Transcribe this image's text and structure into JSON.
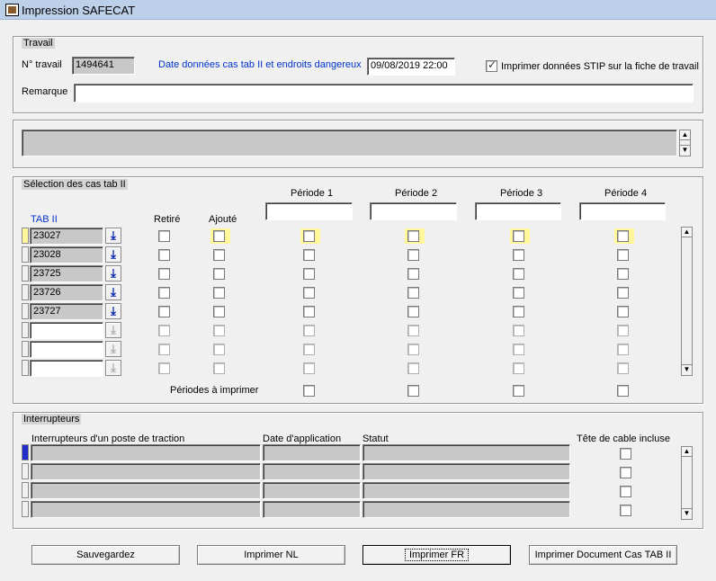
{
  "window": {
    "title": "Impression SAFECAT"
  },
  "travail": {
    "section_label": "Travail",
    "num_label": "N° travail",
    "num_value": "1494641",
    "date_label": "Date données cas tab II et endroits dangereux",
    "date_value": "09/08/2019 22:00",
    "stip_label": "Imprimer données STIP sur la fiche de travail",
    "stip_checked": true,
    "remarque_label": "Remarque",
    "remarque_value": ""
  },
  "message_area": {
    "value": ""
  },
  "selection": {
    "section_label": "Sélection des cas tab II",
    "col_tab": "TAB II",
    "col_retire": "Retiré",
    "col_ajoute": "Ajouté",
    "periods": [
      "Période 1",
      "Période 2",
      "Période 3",
      "Période 4"
    ],
    "rows": [
      "23027",
      "23028",
      "23725",
      "23726",
      "23727",
      "",
      "",
      ""
    ],
    "periodes_a_imprimer": "Périodes à imprimer"
  },
  "interrupteurs": {
    "section_label": "Interrupteurs",
    "col_name": "Interrupteurs d'un poste de traction",
    "col_date": "Date d'application",
    "col_statut": "Statut",
    "col_tete": "Tête de cable incluse",
    "row_count": 4
  },
  "buttons": {
    "save": "Sauvegardez",
    "print_nl": "Imprimer NL",
    "print_fr": "Imprimer FR",
    "print_doc": "Imprimer Document Cas TAB II"
  }
}
